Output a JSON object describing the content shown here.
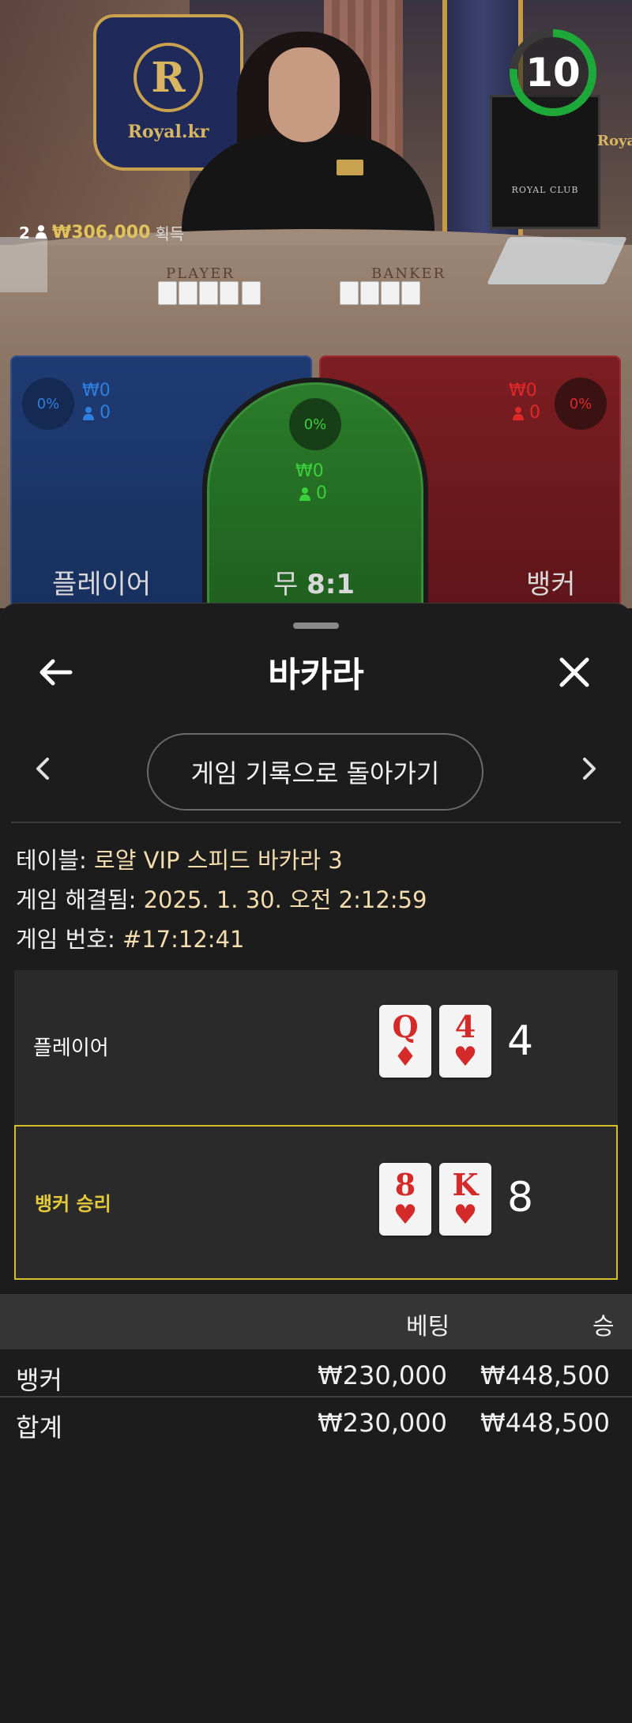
{
  "video": {
    "crest_text": "Royal.kr",
    "crest_letter": "R",
    "side_text": "Royal",
    "club_sign": "ROYAL CLUB",
    "table_player": "PLAYER",
    "table_banker": "BANKER",
    "timer": "10",
    "winners": {
      "count": "2",
      "amount": "₩306,000",
      "suffix": "획득"
    }
  },
  "bet_spots": {
    "player": {
      "percent": "0%",
      "amount": "₩0",
      "players": "0",
      "label": "플레이어",
      "color": "#2f7fe0"
    },
    "tie": {
      "percent": "0%",
      "amount": "₩0",
      "players": "0",
      "label": "무",
      "odds": "8:1",
      "color": "#3ccf3c"
    },
    "banker": {
      "percent": "0%",
      "amount": "₩0",
      "players": "0",
      "label": "뱅커",
      "color": "#e02828"
    }
  },
  "sheet": {
    "title": "바카라",
    "back_history": "게임 기록으로 돌아가기",
    "meta": {
      "table_label": "테이블:",
      "table_value": "로얄 VIP 스피드 바카라 3",
      "resolved_label": "게임 해결됨:",
      "resolved_value": "2025. 1. 30. 오전 2:12:59",
      "number_label": "게임 번호:",
      "number_value": "#17:12:41"
    },
    "hands": {
      "player": {
        "label": "플레이어",
        "total": "4",
        "cards": [
          {
            "rank": "Q",
            "suit": "♦"
          },
          {
            "rank": "4",
            "suit": "♥"
          }
        ]
      },
      "banker": {
        "label": "뱅커 승리",
        "total": "8",
        "cards": [
          {
            "rank": "8",
            "suit": "♥"
          },
          {
            "rank": "K",
            "suit": "♥"
          }
        ]
      }
    },
    "table": {
      "col_bet": "베팅",
      "col_win": "승",
      "rows": [
        {
          "name": "뱅커",
          "bet": "₩230,000",
          "win": "₩448,500"
        },
        {
          "name": "합계",
          "bet": "₩230,000",
          "win": "₩448,500"
        }
      ]
    }
  },
  "colors": {
    "winner_outline": "#d6be2a",
    "accent_meta": "#f3dcae",
    "timer_ring": "#1fa83a"
  }
}
